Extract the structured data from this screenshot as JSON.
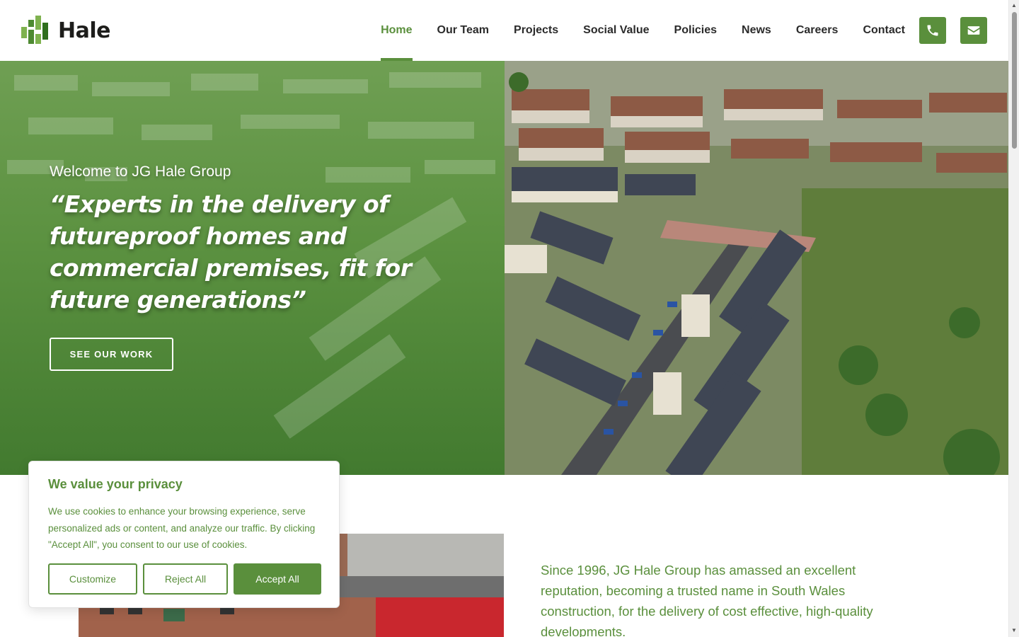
{
  "brand": {
    "name": "Hale",
    "accent_color": "#5a8f3c"
  },
  "nav": {
    "items": [
      {
        "label": "Home",
        "active": true
      },
      {
        "label": "Our Team"
      },
      {
        "label": "Projects"
      },
      {
        "label": "Social Value"
      },
      {
        "label": "Policies"
      },
      {
        "label": "News"
      },
      {
        "label": "Careers"
      },
      {
        "label": "Contact"
      }
    ],
    "icons": [
      "phone-icon",
      "envelope-icon"
    ]
  },
  "hero": {
    "kicker": "Welcome to JG Hale Group",
    "quote": "“Experts in the delivery of futureproof homes and commercial premises, fit for future generations”",
    "button_label": "SEE OUR WORK"
  },
  "intro": {
    "text": "Since 1996, JG Hale Group has amassed an excellent reputation, becoming a trusted name in South Wales construction, for the delivery of cost effective, high-quality developments."
  },
  "cookie": {
    "title": "We value your privacy",
    "body": "We use cookies to enhance your browsing experience, serve personalized ads or content, and analyze our traffic. By clicking \"Accept All\", you consent to our use of cookies.",
    "customize_label": "Customize",
    "reject_label": "Reject All",
    "accept_label": "Accept All"
  }
}
